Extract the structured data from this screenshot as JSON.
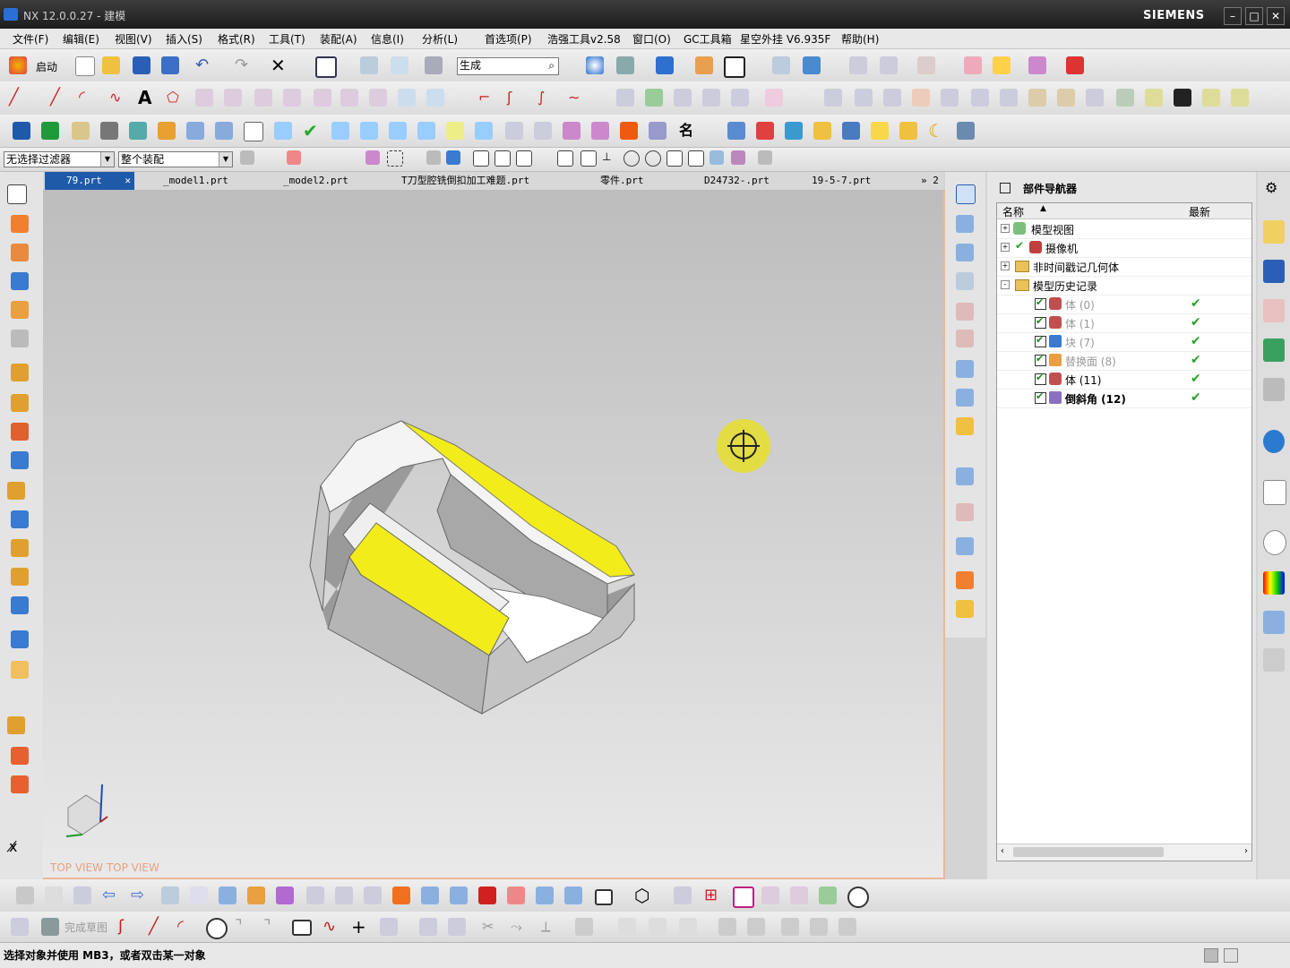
{
  "window": {
    "title": "NX 12.0.0.27 - 建模",
    "brand": "SIEMENS"
  },
  "menu": [
    "文件(F)",
    "编辑(E)",
    "视图(V)",
    "插入(S)",
    "格式(R)",
    "工具(T)",
    "装配(A)",
    "信息(I)",
    "分析(L)",
    "首选项(P)",
    "浩强工具v2.58",
    "窗口(O)",
    "GC工具箱",
    "星空外挂 V6.935F",
    "帮助(H)"
  ],
  "toolbar": {
    "start_label": "启动",
    "command_search_value": "生成"
  },
  "filters": {
    "type_filter": "无选择过滤器",
    "scope_filter": "整个装配"
  },
  "tabs": [
    {
      "label": "79.prt",
      "active": true
    },
    {
      "label": "_model1.prt"
    },
    {
      "label": "_model2.prt"
    },
    {
      "label": "T刀型腔铣倒扣加工难题.prt"
    },
    {
      "label": "零件.prt"
    },
    {
      "label": "D24732-.prt"
    },
    {
      "label": "19-5-7.prt"
    }
  ],
  "tabs_overflow": "» 2",
  "viewport": {
    "view_label": "TOP VIEW  TOP VIEW",
    "model_color": "#f2ec1a"
  },
  "navigator": {
    "title": "部件导航器",
    "col_name": "名称",
    "col_latest": "最新",
    "nodes": [
      {
        "label": "模型视图",
        "level": 0,
        "expander": "+"
      },
      {
        "label": "摄像机",
        "level": 0,
        "expander": "+"
      },
      {
        "label": "非时间戳记几何体",
        "level": 0,
        "expander": "+"
      },
      {
        "label": "模型历史记录",
        "level": 0,
        "expander": "-"
      },
      {
        "label": "体 (0)",
        "level": 1,
        "checked": true,
        "latest": true,
        "dim": true
      },
      {
        "label": "体 (1)",
        "level": 1,
        "checked": true,
        "latest": true,
        "dim": true
      },
      {
        "label": "块 (7)",
        "level": 1,
        "checked": true,
        "latest": true,
        "dim": true
      },
      {
        "label": "替换面 (8)",
        "level": 1,
        "checked": true,
        "latest": true,
        "dim": true
      },
      {
        "label": "体 (11)",
        "level": 1,
        "checked": true,
        "latest": true,
        "dim": false
      },
      {
        "label": "倒斜角 (12)",
        "level": 1,
        "checked": true,
        "latest": true,
        "bold": true
      }
    ]
  },
  "bottom": {
    "finish_sketch": "完成草图"
  },
  "status": {
    "message": "选择对象并使用 MB3，或者双击某一对象"
  }
}
